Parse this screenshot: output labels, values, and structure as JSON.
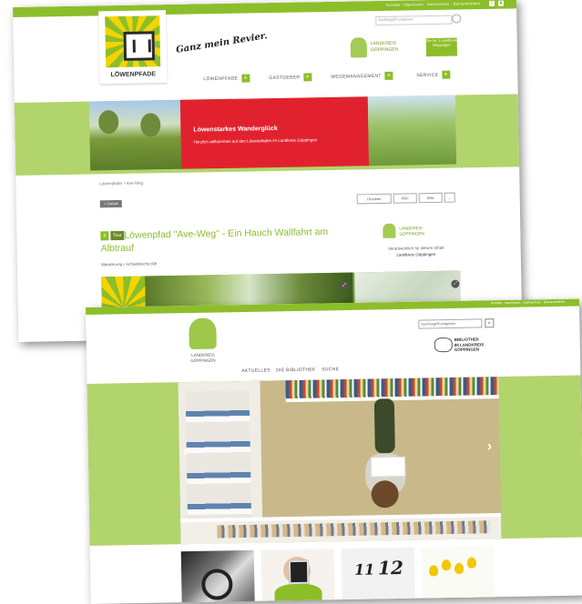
{
  "shot1": {
    "top_links": "Kontakt · Impressum · Datenschutz · Barrierefreiheit",
    "logo_text": "LÖWENPFADE",
    "slogan": "Ganz mein Revier.",
    "search_placeholder": "Suchbegriff eingeben",
    "landkreis": {
      "line1": "LANDKREIS",
      "line2": "GÖPPINGEN"
    },
    "vfb_text": "Die Nr. 1 Landkreis Göppingen",
    "nav": [
      {
        "label": "LÖWENPFADE"
      },
      {
        "label": "GASTGEBER"
      },
      {
        "label": "WEGEMANAGEMENT"
      },
      {
        "label": "SERVICE"
      }
    ],
    "hero": {
      "title": "Löwenstarkes Wanderglück",
      "subtitle": "Herzlich willkommen auf den Löwenpfaden im Landkreis Göppingen"
    },
    "breadcrumb": "Löwenpfade > Ave-Weg",
    "back_label": "< Zurück",
    "tools": {
      "print": "Drucken",
      "pdf": "PDF",
      "kml": "KML",
      "more": "..."
    },
    "badges": {
      "number": "8",
      "type": "Tour"
    },
    "title": "Löwenpfad \"Ave-Weg\" - Ein Hauch Wallfahrt am Albtrauf",
    "subtitle": "Wanderung • Schwäbische Alb",
    "sidebar": {
      "name_line1": "LANDKREIS",
      "name_line2": "GÖPPINGEN",
      "info_line1": "Verantwortlich für diesen Inhalt",
      "info_line2": "Landkreis Göppingen"
    },
    "gallery_button": "⤢"
  },
  "shot2": {
    "top_links": "Kontakt · Impressum · Datenschutz · Barrierefreiheit",
    "logo": {
      "line1": "LANDKREIS",
      "line2": "GÖPPINGEN"
    },
    "search_placeholder": "Suchbegriff eingeben",
    "search_icon": "🔍",
    "bibliothek": {
      "line1": "BIBLIOTHEK",
      "line2": "IM LANDKREIS",
      "line3": "GÖPPINGEN"
    },
    "nav": [
      {
        "label": "AKTUELLES"
      },
      {
        "label": "DIE BIBLIOTHEK"
      },
      {
        "label": "SUCHE"
      }
    ],
    "arrow_left": "‹",
    "arrow_right": "›",
    "clock": {
      "n1": "11",
      "n2": "12"
    }
  },
  "colors": {
    "accent": "#8cbe2a",
    "band": "#b2d46c",
    "hero_red": "#e1222e"
  }
}
